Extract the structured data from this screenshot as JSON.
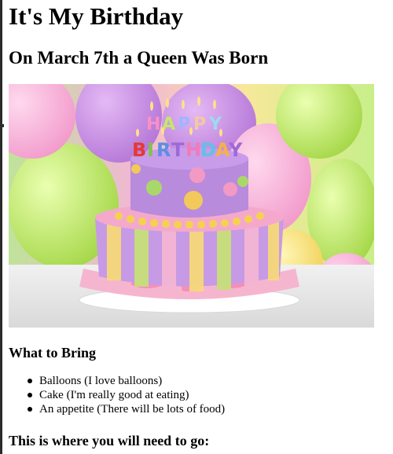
{
  "heading": "It's My Birthday",
  "subheading": "On March 7th a Queen Was Born",
  "hero_image": {
    "alt": "birthday cake",
    "candle_letters": [
      "H",
      "A",
      "P",
      "P",
      "Y",
      "B",
      "I",
      "R",
      "T",
      "H",
      "D",
      "A",
      "Y"
    ]
  },
  "bring_section": {
    "title": "What to Bring",
    "items": [
      "Balloons (I love balloons)",
      "Cake (I'm really good at eating)",
      "An appetite (There will be lots of food)"
    ]
  },
  "directions_title": "This is where you will need to go:"
}
